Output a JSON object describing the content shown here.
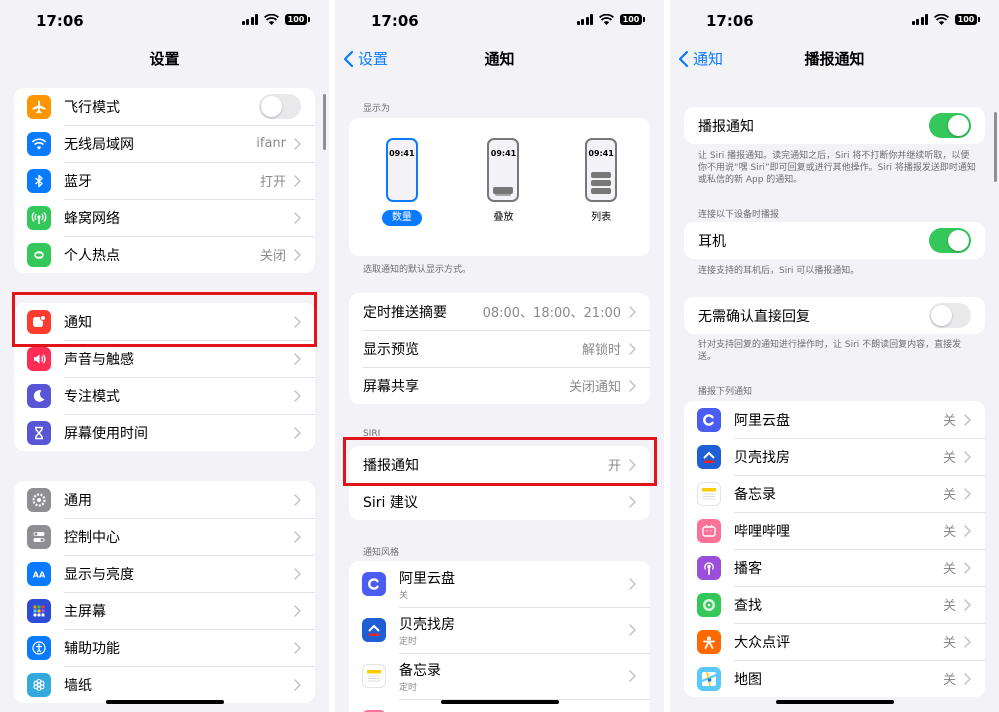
{
  "status": {
    "time": "17:06",
    "battery": "100"
  },
  "panel1": {
    "title": "设置",
    "group1": [
      {
        "label": "飞行模式",
        "icon": "airplane-icon",
        "color": "#ff9500",
        "toggle": false
      },
      {
        "label": "无线局域网",
        "icon": "wifi-icon",
        "color": "#0a7aff",
        "value": "ifanr"
      },
      {
        "label": "蓝牙",
        "icon": "bluetooth-icon",
        "color": "#0a7aff",
        "value": "打开"
      },
      {
        "label": "蜂窝网络",
        "icon": "cellular-icon",
        "color": "#34c759"
      },
      {
        "label": "个人热点",
        "icon": "hotspot-icon",
        "color": "#34c759",
        "value": "关闭"
      }
    ],
    "group2": [
      {
        "label": "通知",
        "icon": "notification-icon",
        "color": "#ff3b30"
      },
      {
        "label": "声音与触感",
        "icon": "sound-icon",
        "color": "#ff2d55"
      },
      {
        "label": "专注模式",
        "icon": "moon-icon",
        "color": "#5856d6"
      },
      {
        "label": "屏幕使用时间",
        "icon": "hourglass-icon",
        "color": "#5856d6"
      }
    ],
    "group3": [
      {
        "label": "通用",
        "icon": "gear-icon",
        "color": "#8e8e93"
      },
      {
        "label": "控制中心",
        "icon": "control-center-icon",
        "color": "#8e8e93"
      },
      {
        "label": "显示与亮度",
        "icon": "display-icon",
        "color": "#0a7aff"
      },
      {
        "label": "主屏幕",
        "icon": "home-screen-icon",
        "color": "#2c4bd6"
      },
      {
        "label": "辅助功能",
        "icon": "accessibility-icon",
        "color": "#0a7aff"
      },
      {
        "label": "墙纸",
        "icon": "wallpaper-icon",
        "color": "#34aadc"
      }
    ]
  },
  "panel2": {
    "back": "设置",
    "title": "通知",
    "display_as_label": "显示为",
    "styles": [
      {
        "caption": "数量",
        "time": "09:41",
        "selected": true
      },
      {
        "caption": "叠放",
        "time": "09:41",
        "selected": false
      },
      {
        "caption": "列表",
        "time": "09:41",
        "selected": false
      }
    ],
    "display_note": "选取通知的默认显示方式。",
    "group1": [
      {
        "label": "定时推送摘要",
        "value": "08:00、18:00、21:00"
      },
      {
        "label": "显示预览",
        "value": "解锁时"
      },
      {
        "label": "屏幕共享",
        "value": "关闭通知"
      }
    ],
    "siri_label": "SIRI",
    "group2": [
      {
        "label": "播报通知",
        "value": "开"
      },
      {
        "label": "Siri 建议",
        "value": ""
      }
    ],
    "style_label": "通知风格",
    "apps": [
      {
        "label": "阿里云盘",
        "sub": "关",
        "icon": "aliyun-drive-icon",
        "color": "#4b5cf0"
      },
      {
        "label": "贝壳找房",
        "sub": "定时",
        "icon": "beike-icon",
        "color": "#1f5fd6"
      },
      {
        "label": "备忘录",
        "sub": "定时",
        "icon": "notes-icon",
        "color": "#ffffff"
      },
      {
        "label": "哔哩哔哩",
        "sub": "",
        "icon": "bilibili-icon",
        "color": "#fb7299"
      }
    ]
  },
  "panel3": {
    "back": "通知",
    "title": "播报通知",
    "announce": {
      "label": "播报通知",
      "toggle": true
    },
    "announce_note": "让 Siri 播报通知。读完通知之后，Siri 将不打断你并继续听取，以便你不用说“嘿 Siri”即可回复或进行其他操作。Siri 将播报发送即时通知或私信的新 App 的通知。",
    "devices_label": "连接以下设备时播报",
    "earphones": {
      "label": "耳机",
      "toggle": true
    },
    "earphones_note": "连接支持的耳机后，Siri 可以播报通知。",
    "reply": {
      "label": "无需确认直接回复",
      "toggle": false
    },
    "reply_note": "针对支持回复的通知进行操作时，让 Siri 不朗读回复内容，直接发送。",
    "apps_label": "播报下列通知",
    "apps": [
      {
        "label": "阿里云盘",
        "value": "关",
        "icon": "aliyun-drive-icon",
        "color": "#4b5cf0"
      },
      {
        "label": "贝壳找房",
        "value": "关",
        "icon": "beike-icon",
        "color": "#1f5fd6"
      },
      {
        "label": "备忘录",
        "value": "关",
        "icon": "notes-icon",
        "color": "#ffffff"
      },
      {
        "label": "哔哩哔哩",
        "value": "关",
        "icon": "bilibili-icon",
        "color": "#fb7299"
      },
      {
        "label": "播客",
        "value": "关",
        "icon": "podcasts-icon",
        "color": "#9b4fd8"
      },
      {
        "label": "查找",
        "value": "关",
        "icon": "find-my-icon",
        "color": "#34c759"
      },
      {
        "label": "大众点评",
        "value": "关",
        "icon": "dianping-icon",
        "color": "#ff6a00"
      },
      {
        "label": "地图",
        "value": "关",
        "icon": "maps-icon",
        "color": "#5ac8fa"
      }
    ]
  }
}
